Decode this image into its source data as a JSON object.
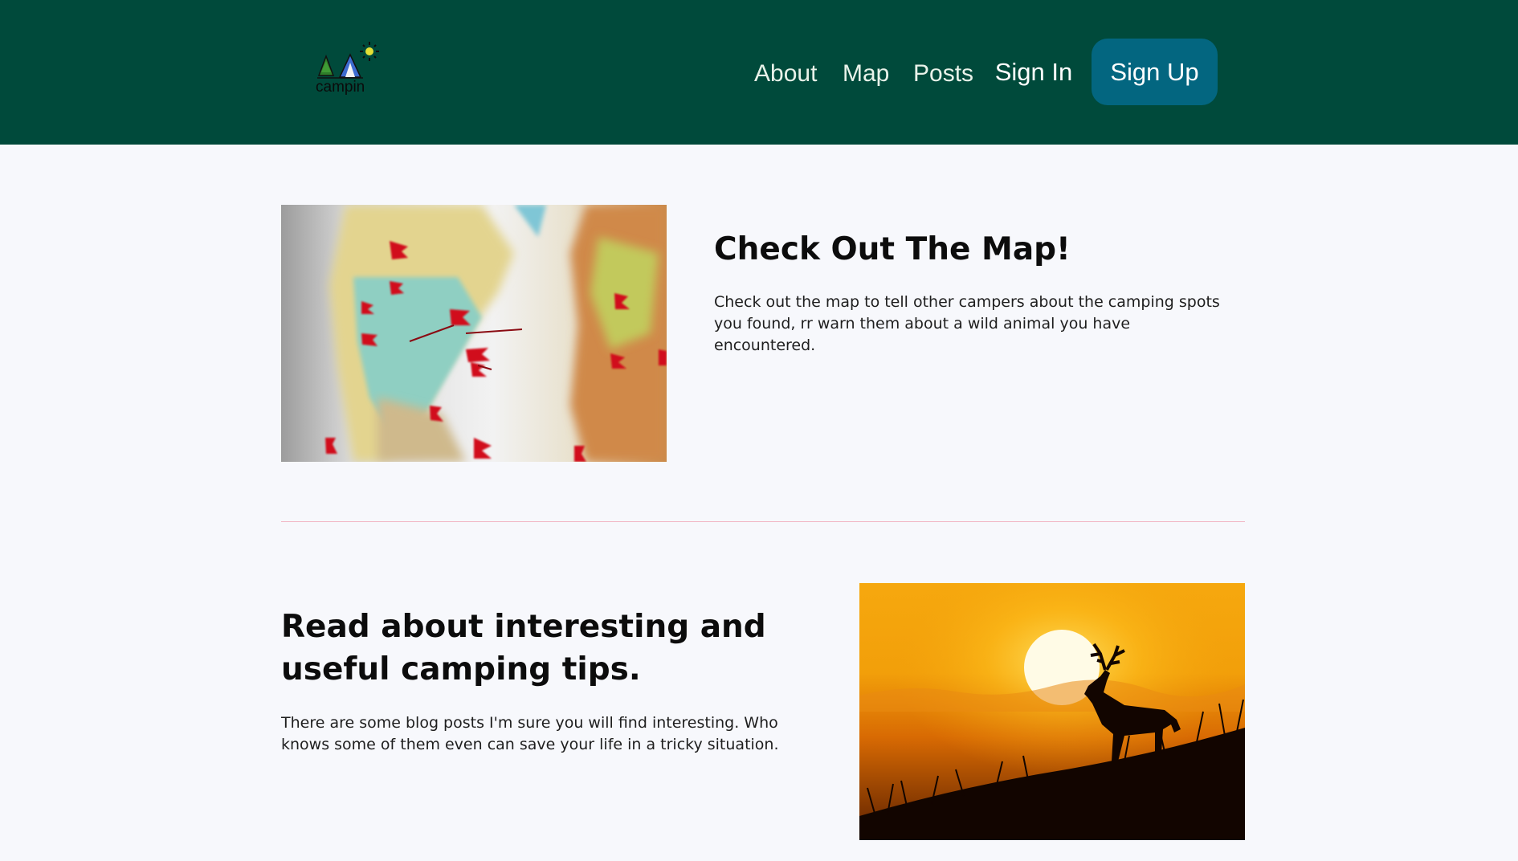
{
  "header": {
    "logo_text": "campin",
    "nav": {
      "about": "About",
      "map": "Map",
      "posts": "Posts",
      "sign_in": "Sign In",
      "sign_up": "Sign Up"
    }
  },
  "sections": {
    "map": {
      "title": "Check Out The Map!",
      "text": "Check out the map to tell other campers about the camping spots you found, rr warn them about a wild animal you have encountered."
    },
    "posts": {
      "title": "Read about interesting and useful camping tips.",
      "text": "There are some blog posts I'm sure you will find interesting. Who knows some of them even can save your life in a tricky situation."
    }
  },
  "colors": {
    "header_bg": "#004a3b",
    "signup_bg": "#036680",
    "page_bg": "#f7f8fc",
    "divider": "#f1b6c4"
  }
}
